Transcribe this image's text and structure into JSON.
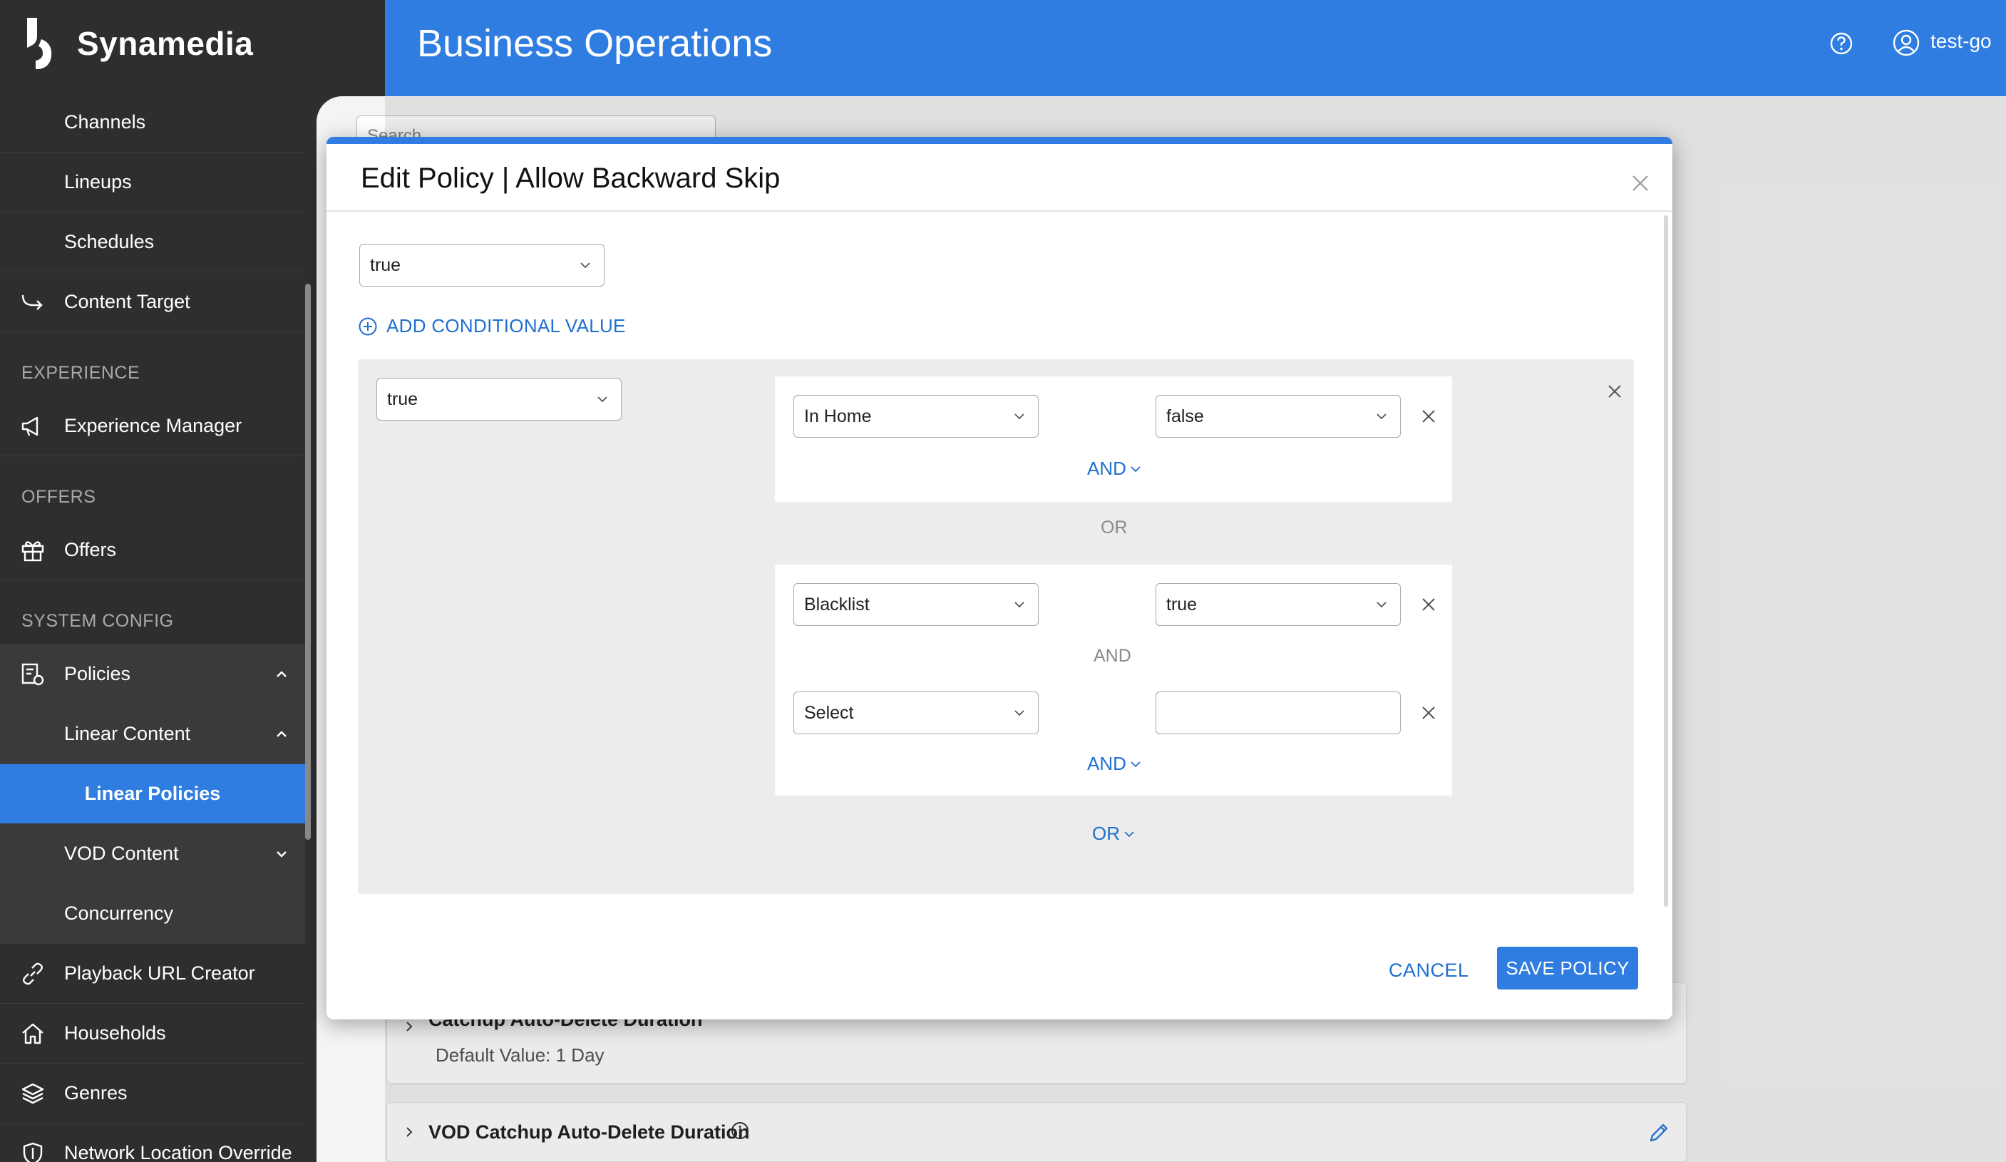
{
  "app": {
    "brand": "Synamedia",
    "header_title": "Business Operations",
    "user": "test-go"
  },
  "sidebar": {
    "items_top": [
      {
        "label": "Channels"
      },
      {
        "label": "Lineups"
      },
      {
        "label": "Schedules"
      },
      {
        "label": "Content Target"
      }
    ],
    "section_experience": "EXPERIENCE",
    "experience_manager": "Experience Manager",
    "section_offers": "OFFERS",
    "offers": "Offers",
    "section_system": "SYSTEM CONFIG",
    "policies": "Policies",
    "linear_content": "Linear Content",
    "linear_policies": "Linear Policies",
    "vod_content": "VOD Content",
    "concurrency": "Concurrency",
    "playback_url": "Playback URL Creator",
    "households": "Households",
    "genres": "Genres",
    "network_override": "Network Location Override"
  },
  "background": {
    "search_placeholder": "Search",
    "card1_title": "Catchup Auto-Delete Duration",
    "card1_default": "Default Value: 1 Day",
    "card2_title": "VOD Catchup Auto-Delete Duration"
  },
  "modal": {
    "title": "Edit Policy | Allow Backward Skip",
    "default_value": "true",
    "add_conditional": "ADD CONDITIONAL VALUE",
    "condition_value": "true",
    "group1": {
      "field": "In Home",
      "value": "false",
      "and_label": "AND"
    },
    "or_label": "OR",
    "group2": {
      "row1_field": "Blacklist",
      "row1_value": "true",
      "and_sep": "AND",
      "row2_field": "Select",
      "row2_value": "",
      "and_label": "AND"
    },
    "or_add": "OR",
    "cancel": "CANCEL",
    "save": "SAVE POLICY"
  },
  "colors": {
    "accent": "#2f7de1",
    "link": "#1f6fd0",
    "sidebar_bg": "#2e2e2e"
  }
}
